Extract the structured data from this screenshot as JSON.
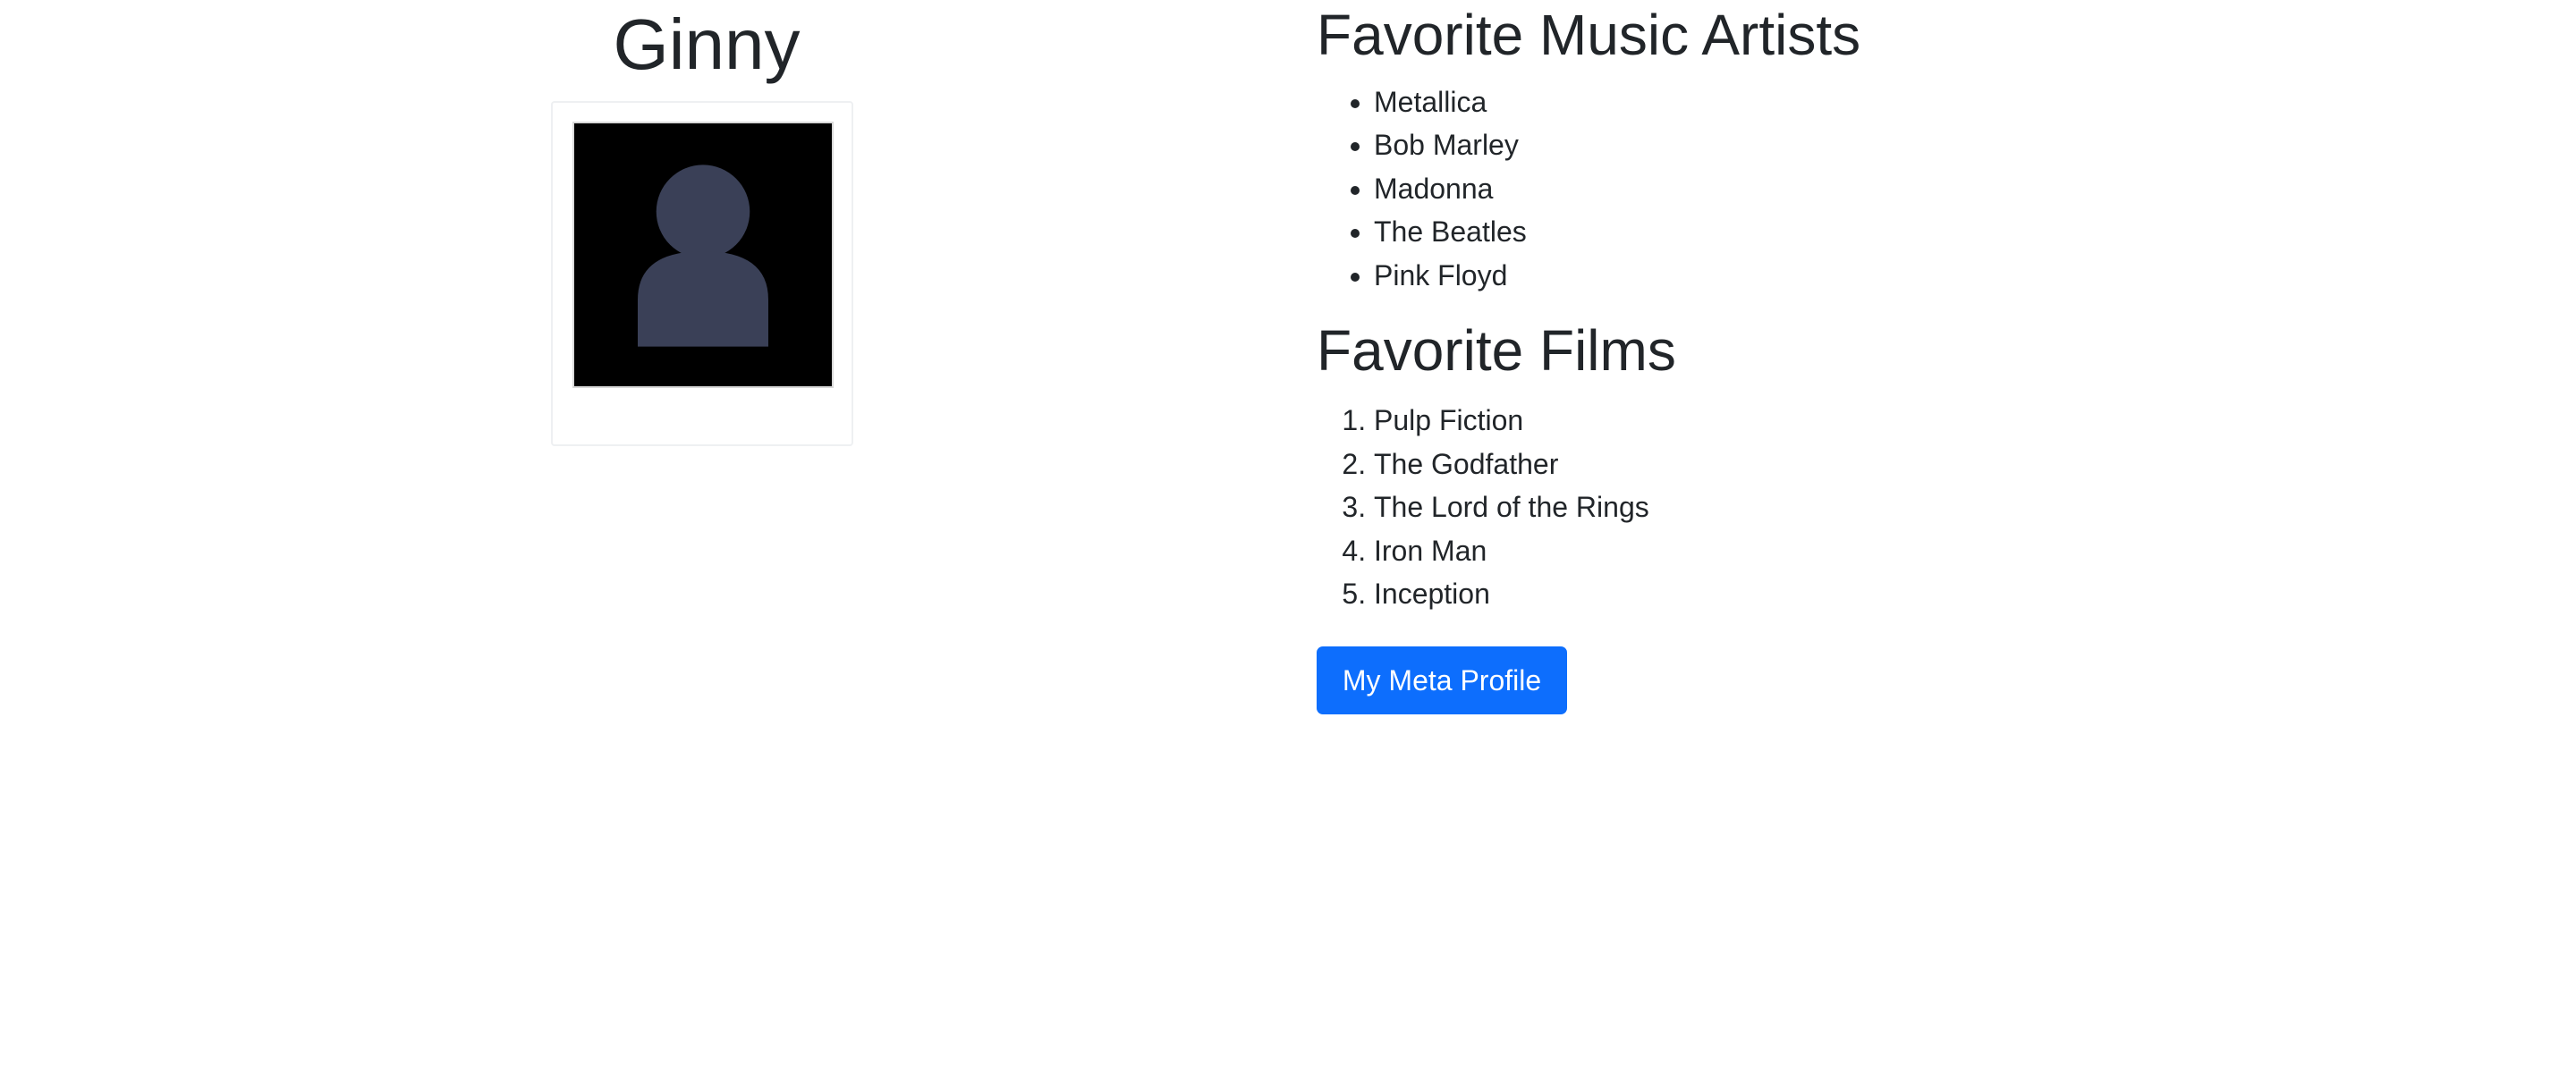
{
  "profile": {
    "name": "Ginny",
    "avatar_icon": "person-silhouette-icon",
    "avatar_colors": {
      "background": "#000000",
      "silhouette": "#3a4057"
    }
  },
  "music": {
    "title": "Favorite Music Artists",
    "items": [
      "Metallica",
      "Bob Marley",
      "Madonna",
      "The Beatles",
      "Pink Floyd"
    ]
  },
  "films": {
    "title": "Favorite Films",
    "items": [
      "Pulp Fiction",
      "The Godfather",
      "The Lord of the Rings",
      "Iron Man",
      "Inception"
    ]
  },
  "actions": {
    "meta_profile_label": "My Meta Profile"
  },
  "colors": {
    "text": "#212529",
    "button_bg": "#0d6efd",
    "button_text": "#ffffff"
  }
}
